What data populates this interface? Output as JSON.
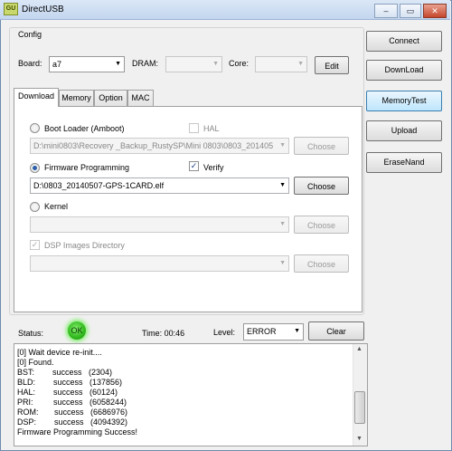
{
  "window": {
    "title": "DirectUSB",
    "icon_text": "GU",
    "minimize": "–",
    "restore": "▭",
    "close": "✕"
  },
  "config": {
    "title": "Config",
    "board_label": "Board:",
    "board_value": "a7",
    "dram_label": "DRAM:",
    "dram_value": "",
    "core_label": "Core:",
    "core_value": "",
    "edit_label": "Edit"
  },
  "tabs": [
    "Download",
    "Memory",
    "Option",
    "MAC"
  ],
  "download": {
    "bootloader_label": "Boot Loader (Amboot)",
    "bootloader_path": "D:\\mini0803\\Recovery _Backup_RustySP\\Mini 0803\\0803_201405",
    "hal_label": "HAL",
    "firmware_label": "Firmware Programming",
    "firmware_path": "D:\\0803_20140507-GPS-1CARD.elf",
    "verify_label": "Verify",
    "kernel_label": "Kernel",
    "kernel_path": "",
    "dsp_label": "DSP Images Directory",
    "dsp_path": "",
    "choose_label": "Choose"
  },
  "side_buttons": [
    "Connect",
    "DownLoad",
    "MemoryTest",
    "Upload",
    "EraseNand"
  ],
  "status": {
    "label": "Status:",
    "indicator": "OK",
    "time_label": "Time: 00:46",
    "level_label": "Level:",
    "level_value": "ERROR",
    "clear_label": "Clear"
  },
  "log": [
    "[0] Wait device re-init....",
    "[0] Found.",
    "BST:        success   (2304)",
    "BLD:        success   (137856)",
    "HAL:        success   (60124)",
    "PRI:         success   (6058244)",
    "ROM:       success   (6686976)",
    "DSP:        success   (4094392)",
    "Firmware Programming Success!"
  ],
  "colors": {
    "status_ok": "#2fb81c",
    "accent": "#3c7fb1"
  }
}
